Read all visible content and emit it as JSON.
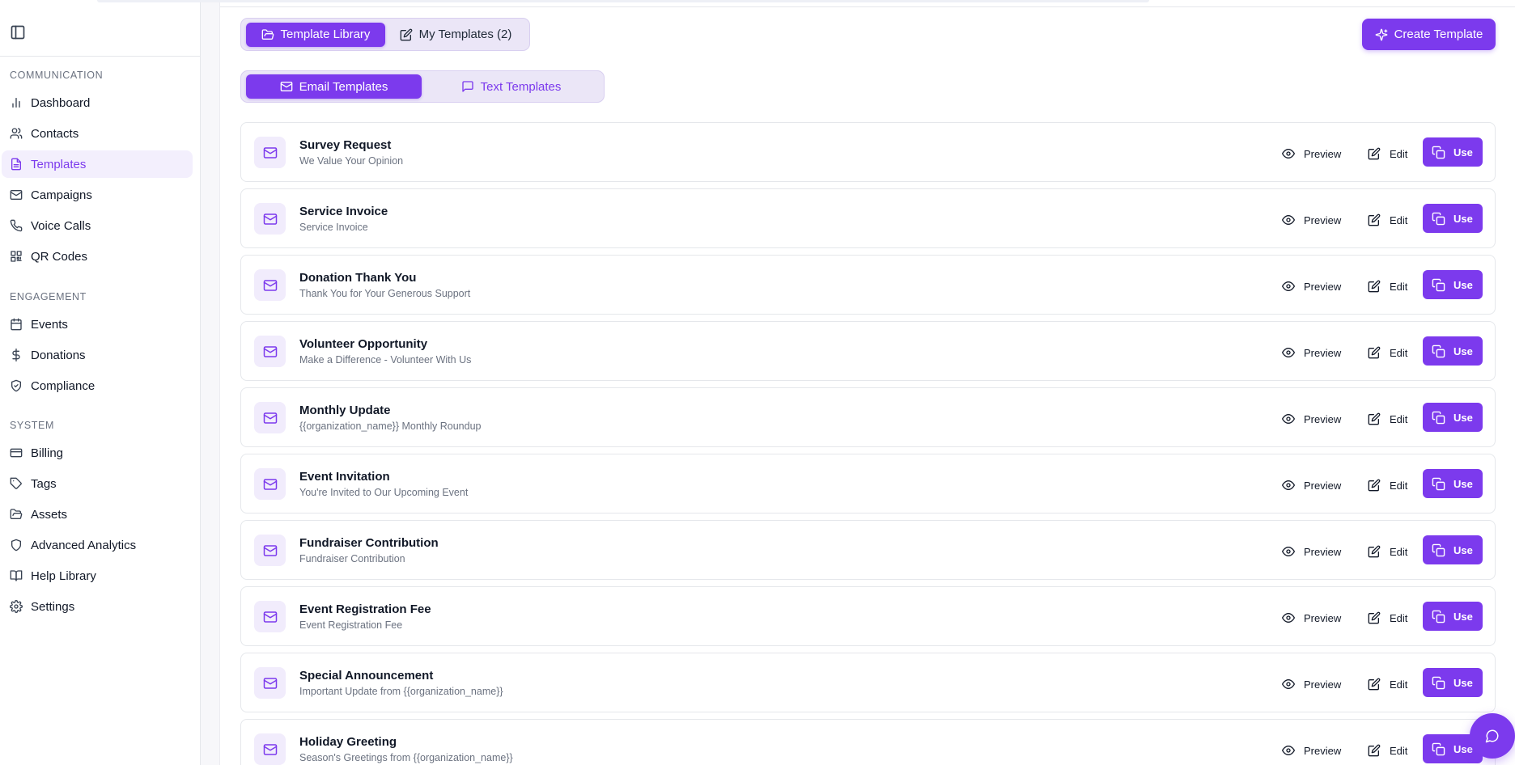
{
  "sidebar": {
    "sections": [
      {
        "label": "COMMUNICATION",
        "items": [
          {
            "label": "Dashboard",
            "icon": "bar-chart-icon",
            "active": false
          },
          {
            "label": "Contacts",
            "icon": "users-icon",
            "active": false
          },
          {
            "label": "Templates",
            "icon": "file-text-icon",
            "active": true
          },
          {
            "label": "Campaigns",
            "icon": "mail-icon",
            "active": false
          },
          {
            "label": "Voice Calls",
            "icon": "phone-icon",
            "active": false
          },
          {
            "label": "QR Codes",
            "icon": "qr-code-icon",
            "active": false
          }
        ]
      },
      {
        "label": "ENGAGEMENT",
        "items": [
          {
            "label": "Events",
            "icon": "calendar-icon",
            "active": false
          },
          {
            "label": "Donations",
            "icon": "dollar-icon",
            "active": false
          },
          {
            "label": "Compliance",
            "icon": "shield-check-icon",
            "active": false
          }
        ]
      },
      {
        "label": "SYSTEM",
        "items": [
          {
            "label": "Billing",
            "icon": "credit-card-icon",
            "active": false
          },
          {
            "label": "Tags",
            "icon": "tag-icon",
            "active": false
          },
          {
            "label": "Assets",
            "icon": "folder-icon",
            "active": false
          },
          {
            "label": "Advanced Analytics",
            "icon": "shield-icon",
            "active": false
          },
          {
            "label": "Help Library",
            "icon": "book-icon",
            "active": false
          },
          {
            "label": "Settings",
            "icon": "gear-icon",
            "active": false
          }
        ]
      }
    ]
  },
  "tabs": {
    "library": "Template Library",
    "mine": "My Templates (2)"
  },
  "type_tabs": {
    "email": "Email Templates",
    "text": "Text Templates"
  },
  "create_button": "Create Template",
  "actions": {
    "preview": "Preview",
    "edit": "Edit",
    "use": "Use"
  },
  "templates": [
    {
      "title": "Survey Request",
      "subject": "We Value Your Opinion"
    },
    {
      "title": "Service Invoice",
      "subject": "Service Invoice"
    },
    {
      "title": "Donation Thank You",
      "subject": "Thank You for Your Generous Support"
    },
    {
      "title": "Volunteer Opportunity",
      "subject": "Make a Difference - Volunteer With Us"
    },
    {
      "title": "Monthly Update",
      "subject": "{{organization_name}} Monthly Roundup"
    },
    {
      "title": "Event Invitation",
      "subject": "You're Invited to Our Upcoming Event"
    },
    {
      "title": "Fundraiser Contribution",
      "subject": "Fundraiser Contribution"
    },
    {
      "title": "Event Registration Fee",
      "subject": "Event Registration Fee"
    },
    {
      "title": "Special Announcement",
      "subject": "Important Update from {{organization_name}}"
    },
    {
      "title": "Holiday Greeting",
      "subject": "Season's Greetings from {{organization_name}}"
    }
  ],
  "colors": {
    "accent": "#7c3aed",
    "accent_light": "#f1ecfc"
  }
}
